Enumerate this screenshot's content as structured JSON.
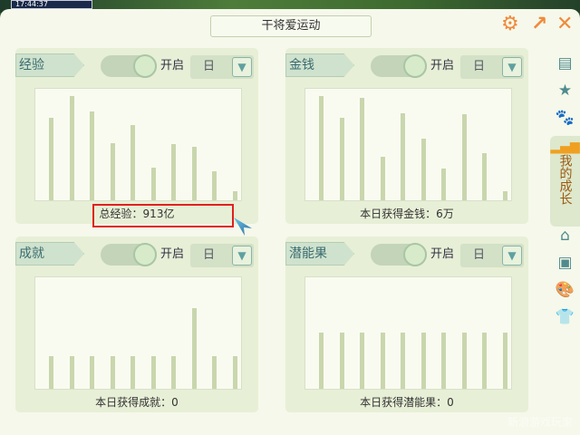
{
  "status_time": "17:44:37",
  "title": "干将爱运动",
  "icons": {
    "settings": "gear-icon",
    "minimize": "arrow-icon",
    "close": "close-icon"
  },
  "panels": [
    {
      "label": "经验",
      "toggle_label": "开启",
      "period": "日",
      "footer": "总经验：913亿",
      "values": [
        91,
        115,
        98,
        63,
        83,
        36,
        62,
        59,
        32,
        10
      ]
    },
    {
      "label": "金钱",
      "toggle_label": "开启",
      "period": "日",
      "footer": "本日获得金钱：6万",
      "values": [
        115,
        91,
        113,
        48,
        96,
        68,
        35,
        95,
        52,
        10
      ]
    },
    {
      "label": "成就",
      "toggle_label": "开启",
      "period": "日",
      "footer": "本日获得成就：0",
      "values": [
        36,
        36,
        36,
        36,
        36,
        36,
        36,
        89,
        36,
        36
      ]
    },
    {
      "label": "潜能果",
      "toggle_label": "开启",
      "period": "日",
      "footer": "本日获得潜能果：0",
      "values": [
        62,
        62,
        62,
        62,
        62,
        62,
        62,
        62,
        62,
        62
      ]
    }
  ],
  "sidebar": {
    "active_label": "我的成长",
    "items": [
      "chat",
      "star",
      "paw",
      "growth",
      "home",
      "box",
      "palette",
      "shirt"
    ]
  },
  "watermark": "新浪游戏玩家"
}
